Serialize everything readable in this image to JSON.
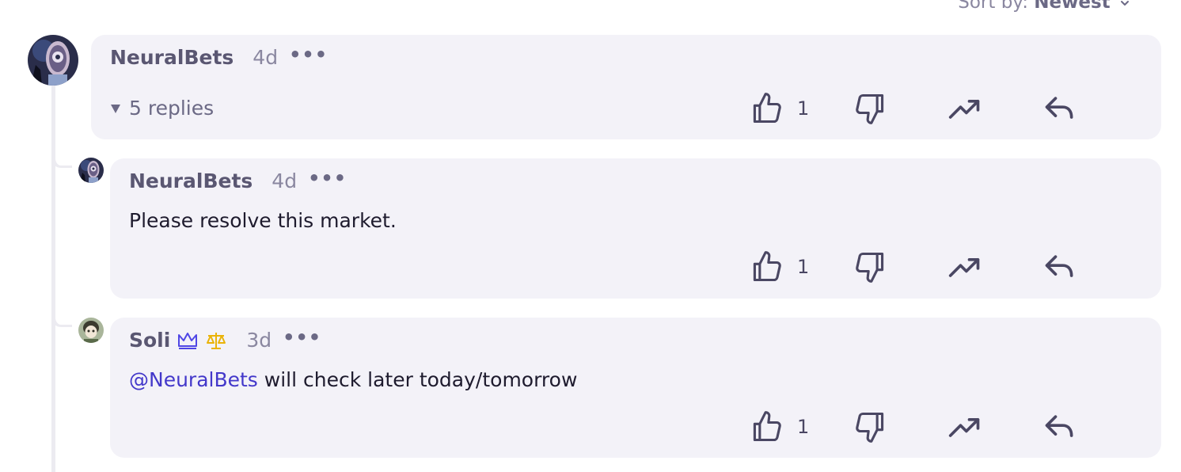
{
  "sort": {
    "label": "Sort by:",
    "value": "Newest"
  },
  "comments": [
    {
      "author": "NeuralBets",
      "time": "4d",
      "menu": "•••",
      "replies_toggle": "5 replies",
      "likes": "1"
    },
    {
      "author": "NeuralBets",
      "time": "4d",
      "menu": "•••",
      "text": "Please resolve this market.",
      "likes": "1"
    },
    {
      "author": "Soli",
      "time": "3d",
      "menu": "•••",
      "mention": "@NeuralBets",
      "text": " will check later today/tomorrow",
      "likes": "1"
    }
  ],
  "icons": {
    "like": "thumbs-up-icon",
    "dislike": "thumbs-down-icon",
    "boost": "trending-up-icon",
    "reply": "reply-icon",
    "crown": "crown-icon",
    "scales": "scales-icon"
  },
  "colors": {
    "accent": "#4338ca",
    "card": "#f3f2f8",
    "badge_blue": "#4f46e5",
    "badge_gold": "#eab308"
  }
}
